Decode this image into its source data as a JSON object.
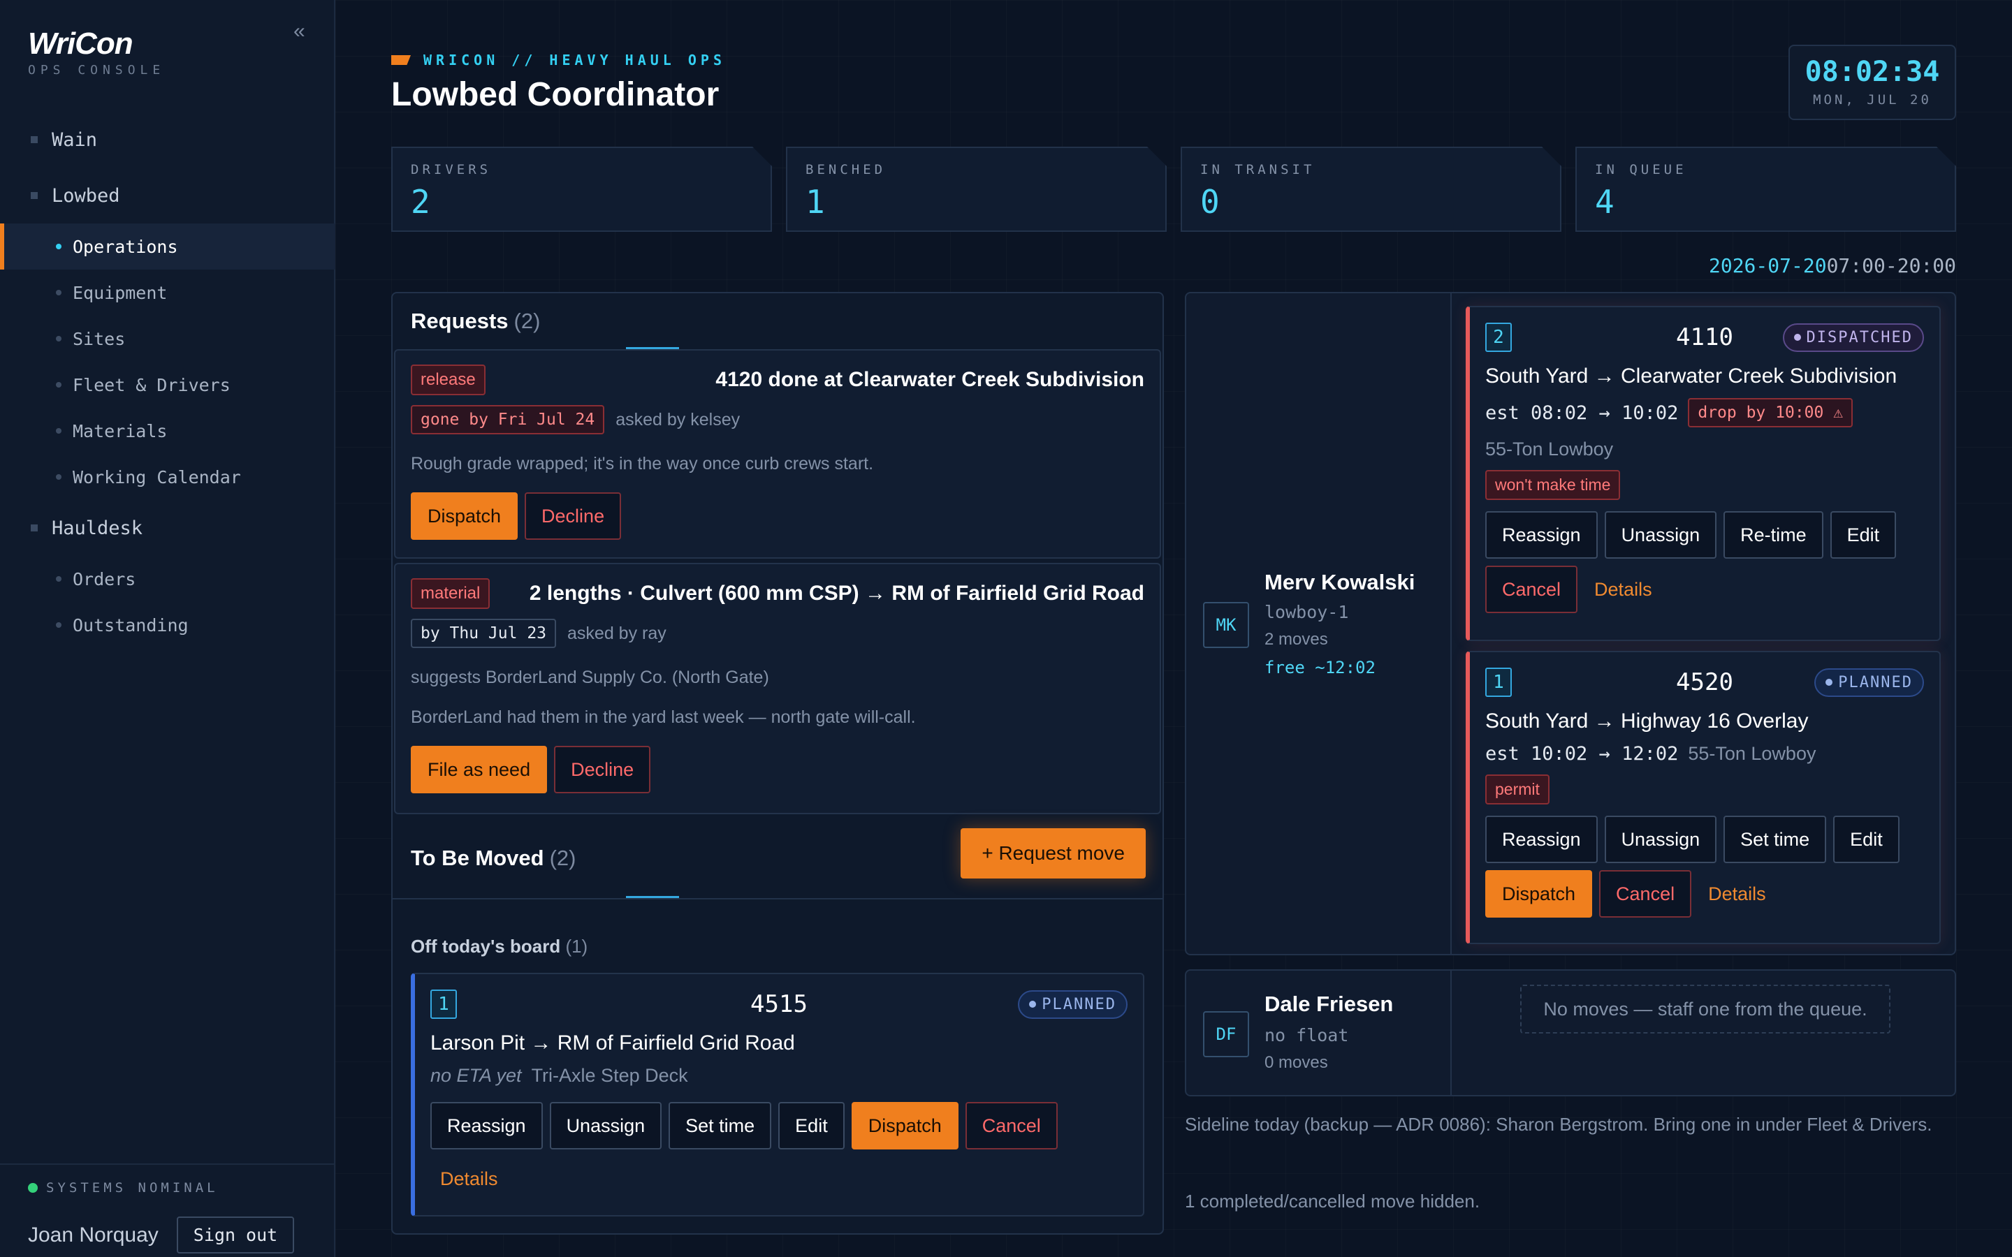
{
  "sidebar": {
    "logo": "WriCon",
    "logo_sub": "OPS CONSOLE",
    "collapse": "«",
    "groups": [
      {
        "label": "Wain"
      },
      {
        "label": "Lowbed",
        "items": [
          "Operations",
          "Equipment",
          "Sites",
          "Fleet & Drivers",
          "Materials",
          "Working Calendar"
        ]
      },
      {
        "label": "Hauldesk",
        "items": [
          "Orders",
          "Outstanding"
        ]
      }
    ],
    "status": "SYSTEMS NOMINAL",
    "user": "Joan Norquay",
    "signout": "Sign out"
  },
  "header": {
    "eyebrow": "WRICON // HEAVY HAUL OPS",
    "title": "Lowbed Coordinator",
    "clock_time": "08:02:34",
    "clock_date": "MON, JUL 20"
  },
  "stats": [
    {
      "label": "DRIVERS",
      "value": "2"
    },
    {
      "label": "BENCHED",
      "value": "1"
    },
    {
      "label": "IN TRANSIT",
      "value": "0"
    },
    {
      "label": "IN QUEUE",
      "value": "4"
    }
  ],
  "date_range": {
    "date": "2026-07-20",
    "hours": "07:00-20:00"
  },
  "requests": {
    "title": "Requests",
    "count": "(2)",
    "items": [
      {
        "tag": "release",
        "title": "4120 done at Clearwater Creek Subdivision",
        "due": "gone by Fri Jul 24",
        "asked": "asked by kelsey",
        "note": "Rough grade wrapped; it's in the way once curb crews start.",
        "primary": "Dispatch",
        "secondary": "Decline"
      },
      {
        "tag": "material",
        "title": "2 lengths · Culvert (600 mm CSP) → RM of Fairfield Grid Road",
        "due": "by Thu Jul 23",
        "asked": "asked by ray",
        "note1": "suggests BorderLand Supply Co. (North Gate)",
        "note2": "BorderLand had them in the yard last week — north gate will-call.",
        "primary": "File as need",
        "secondary": "Decline"
      }
    ]
  },
  "to_be_moved": {
    "title": "To Be Moved",
    "count": "(2)",
    "button": "+ Request move"
  },
  "off_board": {
    "title": "Off today's board",
    "count": "(1)",
    "card": {
      "seq": "1",
      "id": "4515",
      "status": "PLANNED",
      "route": "Larson Pit → RM of Fairfield Grid Road",
      "eta": "no ETA yet",
      "equip": "Tri-Axle Step Deck",
      "buttons": [
        "Reassign",
        "Unassign",
        "Set time",
        "Edit",
        "Dispatch",
        "Cancel"
      ],
      "details": "Details"
    }
  },
  "drivers": [
    {
      "initials": "MK",
      "name": "Merv Kowalski",
      "rig": "lowboy-1",
      "moves": "2 moves",
      "free": "free ~12:02",
      "cards": [
        {
          "seq": "2",
          "id": "4110",
          "status": "DISPATCHED",
          "route": "South Yard → Clearwater Creek Subdivision",
          "eta": "est 08:02 → 10:02",
          "drop": "drop by 10:00 ⚠",
          "equip": "55-Ton Lowboy",
          "warn": "won't make time",
          "buttons": [
            "Reassign",
            "Unassign",
            "Re-time",
            "Edit"
          ],
          "cancel": "Cancel",
          "details": "Details"
        },
        {
          "seq": "1",
          "id": "4520",
          "status": "PLANNED",
          "route": "South Yard → Highway 16 Overlay",
          "eta": "est 10:02 → 12:02",
          "equip": "55-Ton Lowboy",
          "warn": "permit",
          "buttons": [
            "Reassign",
            "Unassign",
            "Set time",
            "Edit"
          ],
          "dispatch": "Dispatch",
          "cancel": "Cancel",
          "details": "Details"
        }
      ]
    },
    {
      "initials": "DF",
      "name": "Dale Friesen",
      "rig": "no float",
      "moves": "0 moves",
      "empty": "No moves — staff one from the queue."
    }
  ],
  "footnotes": {
    "sideline": "Sideline today (backup — ADR 0086): Sharon Bergstrom. Bring one in under Fleet & Drivers.",
    "hidden": "1 completed/cancelled move hidden."
  },
  "colors": {
    "accent": "#f07f1e",
    "cyan": "#4fd6f5",
    "danger": "#ff6a6a",
    "background": "#0b1424"
  }
}
